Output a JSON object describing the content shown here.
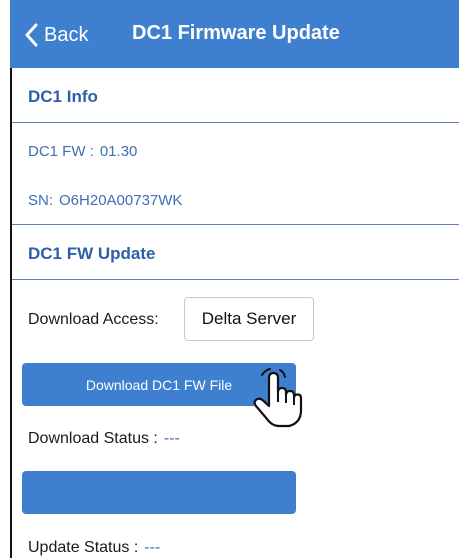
{
  "navbar": {
    "back_label": "Back",
    "title": "DC1 Firmware Update"
  },
  "info_section": {
    "header": "DC1 Info",
    "fw_label": "DC1 FW :",
    "fw_value": "01.30",
    "sn_label": "SN:",
    "sn_value": "O6H20A00737WK"
  },
  "update_section": {
    "header": "DC1 FW Update",
    "access_label": "Download Access:",
    "access_value": "Delta Server",
    "download_button_label": "Download DC1 FW File",
    "download_status_label": "Download Status :",
    "download_status_value": "---",
    "update_button_label": "",
    "update_status_label": "Update Status :",
    "update_status_value": "---"
  },
  "colors": {
    "accent": "#3e7fcf",
    "section_text": "#2f5fa8",
    "info_text": "#3f6fb5"
  }
}
